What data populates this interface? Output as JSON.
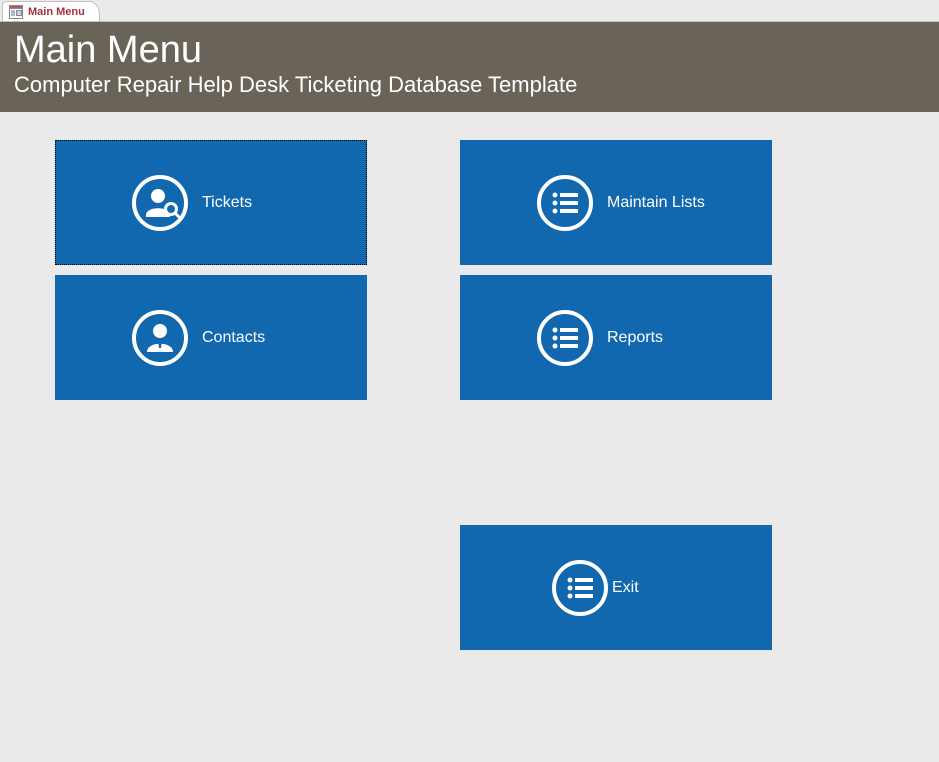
{
  "tab": {
    "label": "Main Menu"
  },
  "header": {
    "title": "Main Menu",
    "subtitle": "Computer Repair Help Desk Ticketing Database Template"
  },
  "tiles": {
    "tickets": "Tickets",
    "contacts": "Contacts",
    "maintain": "Maintain Lists",
    "reports": "Reports",
    "exit": "Exit"
  },
  "colors": {
    "tile_bg": "#1268ae",
    "header_bg": "#6a6358",
    "tab_text": "#a03040"
  }
}
